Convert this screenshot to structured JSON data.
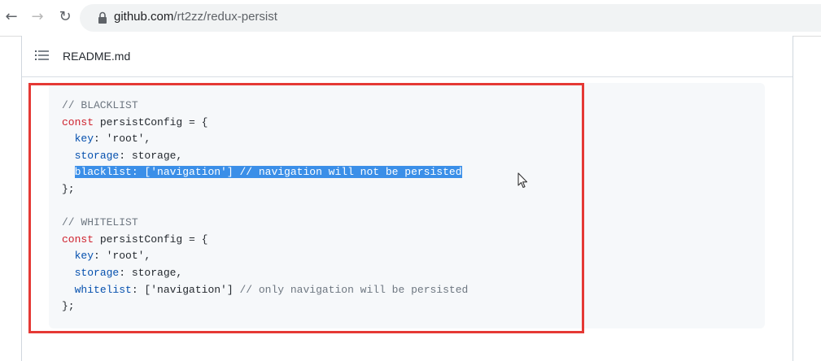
{
  "browser": {
    "url_host": "github.com",
    "url_path": "/rt2zz/redux-persist",
    "icons": [
      "back-arrow-icon",
      "forward-arrow-icon",
      "reload-icon",
      "lock-icon"
    ]
  },
  "readme": {
    "title": "README.md",
    "toc_icon": "list-icon"
  },
  "code": {
    "blacklist_comment": "// BLACKLIST",
    "bl_const": "const",
    "bl_name": " persistConfig = {",
    "bl_key_prop": "key",
    "bl_key_rest": ": 'root',",
    "bl_storage_prop": "storage",
    "bl_storage_rest": ": storage,",
    "bl_list_prop": "blacklist",
    "bl_list_rest": ": ['navigation'] // navigation will not be persisted",
    "bl_close": "};",
    "whitelist_comment": "// WHITELIST",
    "wl_const": "const",
    "wl_name": " persistConfig = {",
    "wl_key_prop": "key",
    "wl_key_rest": ": 'root',",
    "wl_storage_prop": "storage",
    "wl_storage_rest": ": storage,",
    "wl_list_prop": "whitelist",
    "wl_list_str": ": ['navigation'] ",
    "wl_list_comment": "// only navigation will be persisted",
    "wl_close": "};"
  },
  "colors": {
    "highlight_frame": "#e53935",
    "selection": "#3b8fe8",
    "keyword": "#cf222e",
    "property": "#0550ae"
  }
}
